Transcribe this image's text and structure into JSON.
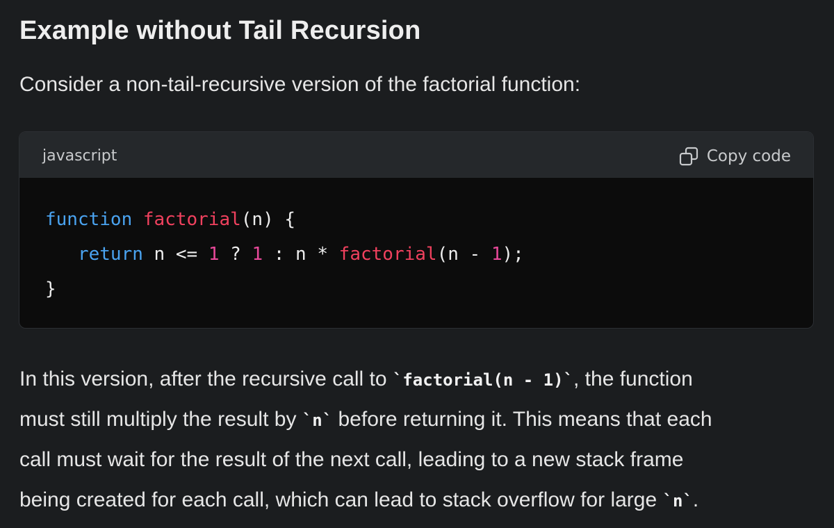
{
  "heading": "Example without Tail Recursion",
  "intro": "Consider a non-tail-recursive version of the factorial function:",
  "code_block": {
    "language": "javascript",
    "copy_label": "Copy code",
    "copy_icon": "copy-icon",
    "lines": [
      [
        {
          "text": "function",
          "type": "kw"
        },
        {
          "text": " ",
          "type": "plain"
        },
        {
          "text": "factorial",
          "type": "fn"
        },
        {
          "text": "(n) {",
          "type": "plain"
        }
      ],
      [
        {
          "text": "   ",
          "type": "plain"
        },
        {
          "text": "return",
          "type": "kw"
        },
        {
          "text": " n <= ",
          "type": "plain"
        },
        {
          "text": "1",
          "type": "num"
        },
        {
          "text": " ? ",
          "type": "plain"
        },
        {
          "text": "1",
          "type": "num"
        },
        {
          "text": " : n * ",
          "type": "plain"
        },
        {
          "text": "factorial",
          "type": "fn"
        },
        {
          "text": "(n - ",
          "type": "plain"
        },
        {
          "text": "1",
          "type": "num"
        },
        {
          "text": ");",
          "type": "plain"
        }
      ],
      [
        {
          "text": "}",
          "type": "plain"
        }
      ]
    ]
  },
  "paragraph": {
    "lines": [
      [
        {
          "text": "In this version, after the recursive call to ",
          "type": "text"
        },
        {
          "text": "`factorial(n - 1)`",
          "type": "code"
        },
        {
          "text": ", the function",
          "type": "text"
        }
      ],
      [
        {
          "text": "must still multiply the result by ",
          "type": "text"
        },
        {
          "text": "`n`",
          "type": "code"
        },
        {
          "text": " before returning it. This means that each",
          "type": "text"
        }
      ],
      [
        {
          "text": "call must wait for the result of the next call, leading to a new stack frame",
          "type": "text"
        }
      ],
      [
        {
          "text": "being created for each call, which can lead to stack overflow for large ",
          "type": "text"
        },
        {
          "text": "`n`",
          "type": "code"
        },
        {
          "text": ".",
          "type": "text"
        }
      ]
    ]
  },
  "colors": {
    "background": "#1b1d1f",
    "code_header": "#25282b",
    "code_body": "#0c0c0c",
    "keyword": "#4aa3f0",
    "function_name": "#f0415e",
    "number": "#e8499a"
  }
}
